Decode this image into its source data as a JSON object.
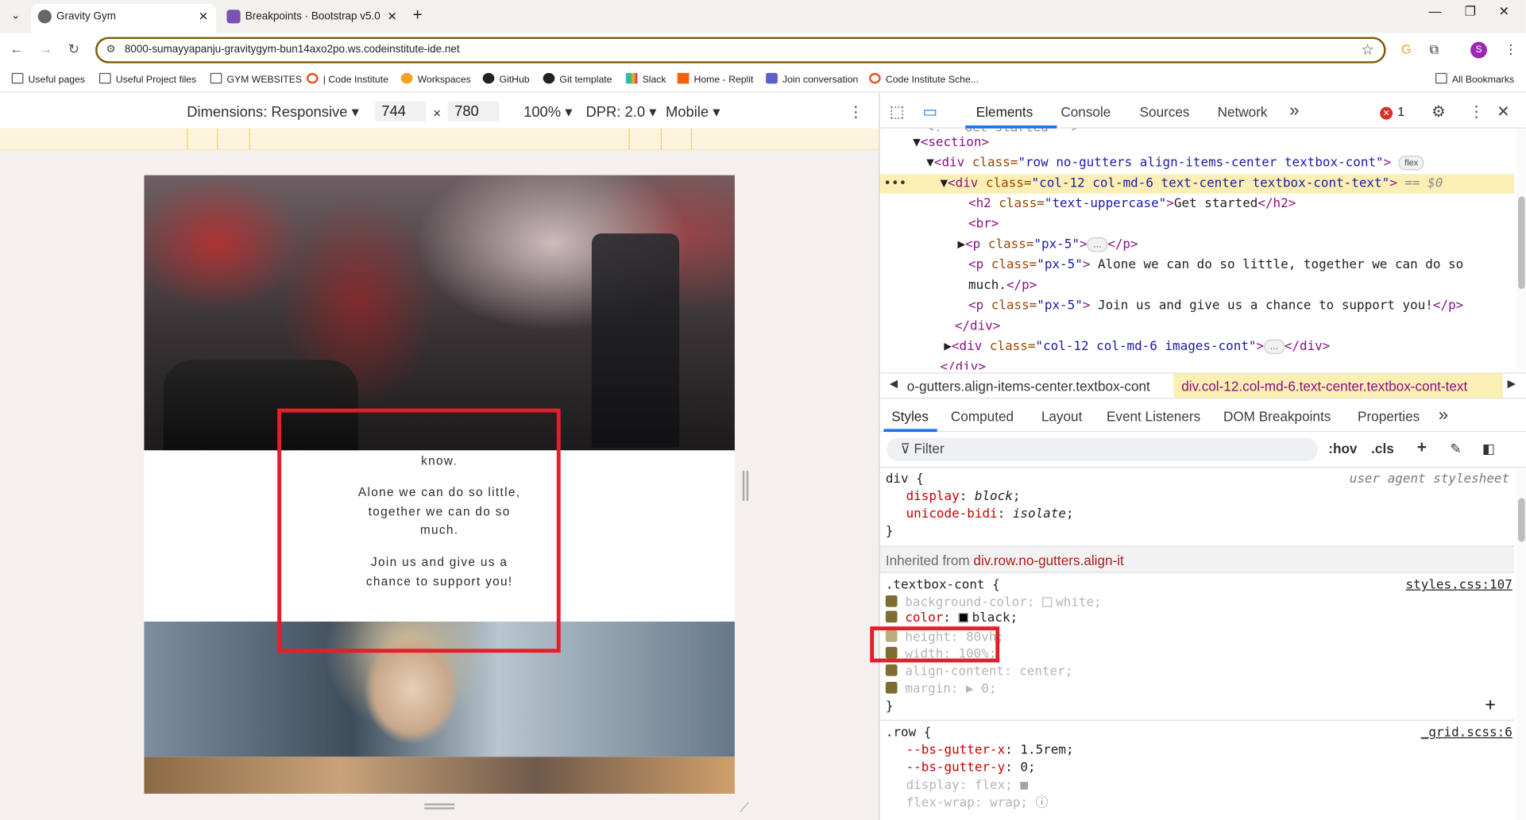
{
  "browser": {
    "tabs": [
      {
        "title": "Gravity Gym",
        "active": true
      },
      {
        "title": "Breakpoints · Bootstrap v5.0",
        "active": false
      }
    ],
    "url": "8000-sumayyapanju-gravitygym-bun14axo2po.ws.codeinstitute-ide.net",
    "profile_initial": "S",
    "bookmarks": [
      "Useful pages",
      "Useful Project files",
      "GYM WEBSITES",
      "| Code Institute",
      "Workspaces",
      "GitHub",
      "Git template",
      "Slack",
      "Home - Replit",
      "Join conversation",
      "Code Institute Sche..."
    ],
    "all_bookmarks": "All Bookmarks",
    "bookmark_icon_colors": [
      "#555555",
      "#555555",
      "#555555",
      "#e8541f",
      "#f4a21b",
      "#222222",
      "#222222",
      "#4a154b",
      "#f26207",
      "#5b5fc7",
      "#e8541f"
    ]
  },
  "device_toolbar": {
    "dimensions": "Dimensions: Responsive",
    "width": "744",
    "times": "×",
    "height": "780",
    "zoom": "100%",
    "dpr": "DPR: 2.0",
    "mode": "Mobile"
  },
  "preview": {
    "para1": "know.",
    "para2": "Alone we can do so little, together we can do so much.",
    "para3": "Join us and give us a chance to support you!"
  },
  "devtools": {
    "tabs": [
      "Elements",
      "Console",
      "Sources",
      "Network"
    ],
    "more": "»",
    "error_count": "1",
    "elements": {
      "line0": "Get started",
      "section": "<section>",
      "row_tag": "<div ",
      "row_attr": "class=",
      "row_val": "\"row no-gutters align-items-center textbox-cont\"",
      "row_badge": "flex",
      "sel_attr": "class=",
      "sel_val": "\"col-12 col-md-6 text-center textbox-cont-text\"",
      "sel_marker": "== $0",
      "h2_val": "\"text-uppercase\"",
      "h2_text": "Get started",
      "br": "<br>",
      "p1_val": "\"px-5\"",
      "p2_text": " Alone we can do so little, together we can do so",
      "p2_text_cont": "much.",
      "p3_text": " Join us and give us a chance to support you!",
      "close_div": "</div>",
      "img_val": "\"col-12 col-md-6 images-cont\""
    },
    "breadcrumb": {
      "left": "o-gutters.align-items-center.textbox-cont",
      "right": "div.col-12.col-md-6.text-center.textbox-cont-text"
    },
    "subtabs": [
      "Styles",
      "Computed",
      "Layout",
      "Event Listeners",
      "DOM Breakpoints",
      "Properties"
    ],
    "filter_placeholder": "Filter",
    "filter_tools": [
      ":hov",
      ".cls"
    ],
    "styles": {
      "rule1_selector": "div {",
      "rule1_source": "user agent stylesheet",
      "rule1_props": [
        {
          "name": "display",
          "value": "block"
        },
        {
          "name": "unicode-bidi",
          "value": "isolate"
        }
      ],
      "inherited_label": "Inherited from ",
      "inherited_link": "div.row.no-gutters.align-it ",
      "rule2_selector": ".textbox-cont {",
      "rule2_source": "styles.css:107",
      "rule2_props": [
        {
          "name": "background-color",
          "value": "white"
        },
        {
          "name": "color",
          "value": "black"
        },
        {
          "name": "height",
          "value": "80vh"
        },
        {
          "name": "width",
          "value": "100%"
        },
        {
          "name": "align-content",
          "value": "center"
        },
        {
          "name": "margin",
          "value": "0"
        }
      ],
      "rule3_selector": ".row {",
      "rule3_source": "_grid.scss:6",
      "rule3_props": [
        {
          "name": "--bs-gutter-x",
          "value": "1.5rem"
        },
        {
          "name": "--bs-gutter-y",
          "value": "0"
        },
        {
          "name": "display",
          "value": "flex"
        },
        {
          "name": "flex-wrap",
          "value": "wrap"
        }
      ]
    }
  },
  "colors": {
    "highlight_box": "#e51f2a",
    "selected_row": "#fcefb4",
    "accent": "#1a73e8"
  }
}
